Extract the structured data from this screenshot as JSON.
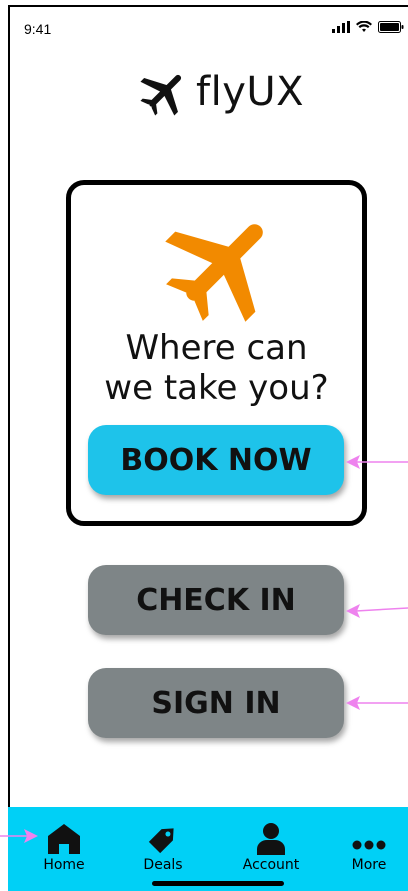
{
  "status_bar": {
    "time": "9:41"
  },
  "app": {
    "name": "flyUX"
  },
  "hero": {
    "headline": "Where can\nwe take you?",
    "plane_color": "#f28a00"
  },
  "buttons": {
    "book_now": "BOOK NOW",
    "check_in": "CHECK IN",
    "sign_in": "SIGN IN"
  },
  "colors": {
    "primary": "#1ec3ea",
    "secondary": "#7e8587",
    "tabbar": "#00d0f6",
    "annotation_arrow": "#ee82ee"
  },
  "tabbar": {
    "items": [
      {
        "label": "Home",
        "icon": "home-icon"
      },
      {
        "label": "Deals",
        "icon": "tag-icon"
      },
      {
        "label": "Account",
        "icon": "user-icon"
      },
      {
        "label": "More",
        "icon": "more-dots-icon"
      }
    ]
  }
}
